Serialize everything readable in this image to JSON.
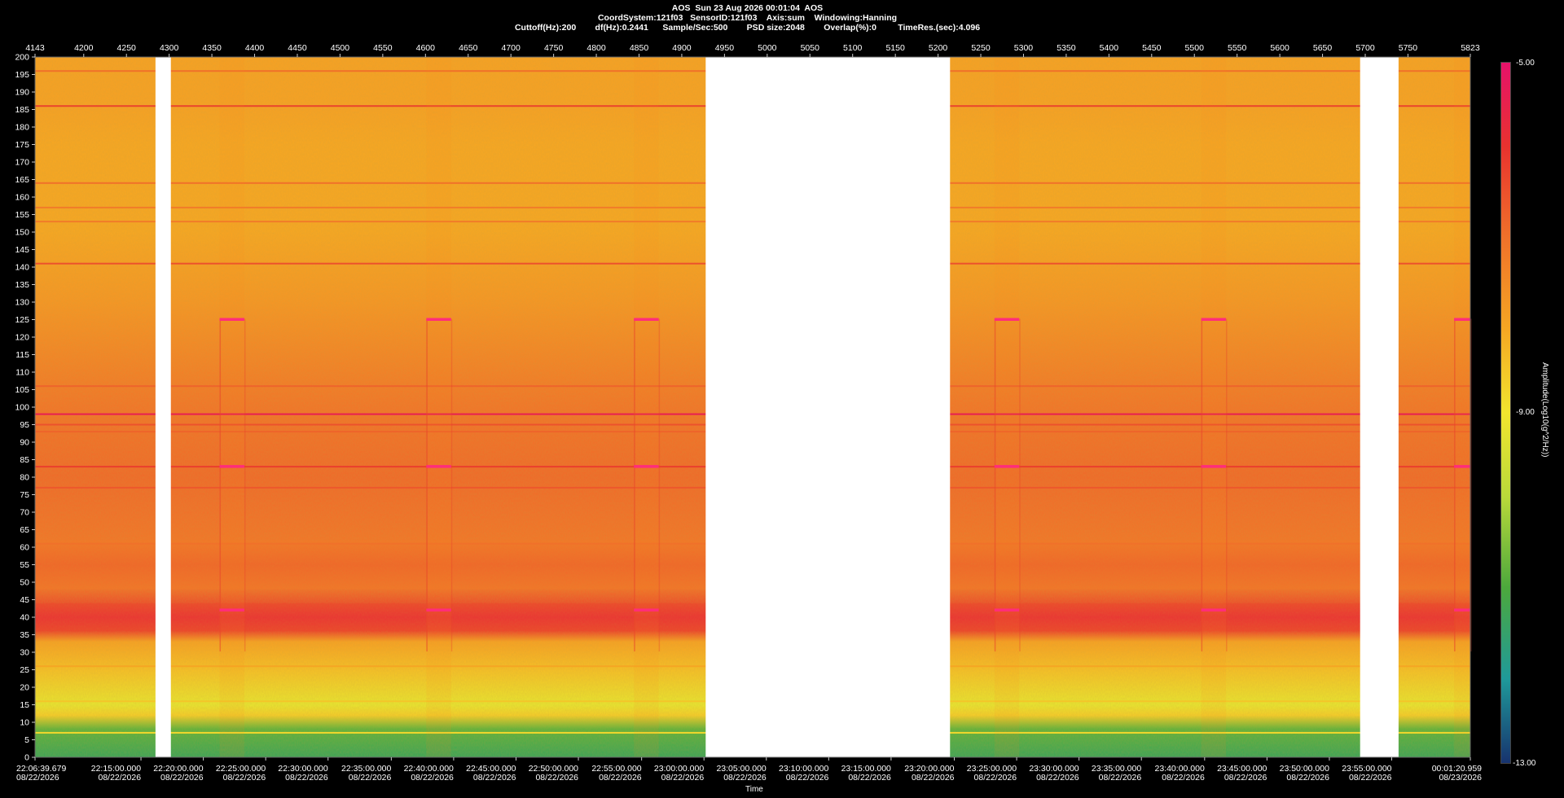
{
  "header": {
    "line1": "AOS  Sun 23 Aug 2026 00:01:04  AOS",
    "line2": "CoordSystem:121f03   SensorID:121f03    Axis:sum    Windowing:Hanning",
    "line3": "Cuttoff(Hz):200        df(Hz):0.2441      Sample/Sec:500        PSD size:2048        Overlap(%):0         TimeRes.(sec):4.096"
  },
  "colorbar": {
    "title": "Amplitude(Log10(g^2/Hz))",
    "max_label": "-5.00",
    "mid_label": "-9.00",
    "min_label": "-13.00",
    "range": [
      -13,
      -5
    ],
    "colors": [
      "#17336e",
      "#1f9a9a",
      "#4ca83c",
      "#b9d93a",
      "#f2e52e",
      "#f5a623",
      "#f0712a",
      "#e8322e",
      "#e6126a"
    ]
  },
  "x_axis_label": "Time",
  "chart_data": {
    "type": "heatmap",
    "title": "AOS  Sun 23 Aug 2026 00:01:04  AOS",
    "xlabel": "Time",
    "ylabel": "",
    "ylim": [
      0,
      200
    ],
    "y_ticks": [
      0,
      5,
      10,
      15,
      20,
      25,
      30,
      35,
      40,
      45,
      50,
      55,
      60,
      65,
      70,
      75,
      80,
      85,
      90,
      95,
      100,
      105,
      110,
      115,
      120,
      125,
      130,
      135,
      140,
      145,
      150,
      155,
      160,
      165,
      170,
      175,
      180,
      185,
      190,
      195,
      200
    ],
    "xlim_index": [
      4143,
      5823
    ],
    "top_ticks": [
      4143,
      4200,
      4250,
      4300,
      4350,
      4400,
      4450,
      4500,
      4550,
      4600,
      4650,
      4700,
      4750,
      4800,
      4850,
      4900,
      4950,
      5000,
      5050,
      5100,
      5150,
      5200,
      5250,
      5300,
      5350,
      5400,
      5450,
      5500,
      5550,
      5600,
      5650,
      5700,
      5750,
      5823
    ],
    "bottom_ticks": [
      {
        "index": 4143,
        "time": "22:06:39.679",
        "date": "08/22/2026"
      },
      {
        "index": 4267,
        "time": "22:15:00.000",
        "date": "08/22/2026"
      },
      {
        "index": 4340,
        "time": "22:20:00.000",
        "date": "08/22/2026"
      },
      {
        "index": 4413,
        "time": "22:25:00.000",
        "date": "08/22/2026"
      },
      {
        "index": 4486,
        "time": "22:30:00.000",
        "date": "08/22/2026"
      },
      {
        "index": 4560,
        "time": "22:35:00.000",
        "date": "08/22/2026"
      },
      {
        "index": 4633,
        "time": "22:40:00.000",
        "date": "08/22/2026"
      },
      {
        "index": 4706,
        "time": "22:45:00.000",
        "date": "08/22/2026"
      },
      {
        "index": 4779,
        "time": "22:50:00.000",
        "date": "08/22/2026"
      },
      {
        "index": 4853,
        "time": "22:55:00.000",
        "date": "08/22/2026"
      },
      {
        "index": 4926,
        "time": "23:00:00.000",
        "date": "08/22/2026"
      },
      {
        "index": 4999,
        "time": "23:05:00.000",
        "date": "08/22/2026"
      },
      {
        "index": 5072,
        "time": "23:10:00.000",
        "date": "08/22/2026"
      },
      {
        "index": 5145,
        "time": "23:15:00.000",
        "date": "08/22/2026"
      },
      {
        "index": 5219,
        "time": "23:20:00.000",
        "date": "08/22/2026"
      },
      {
        "index": 5292,
        "time": "23:25:00.000",
        "date": "08/22/2026"
      },
      {
        "index": 5365,
        "time": "23:30:00.000",
        "date": "08/22/2026"
      },
      {
        "index": 5438,
        "time": "23:35:00.000",
        "date": "08/22/2026"
      },
      {
        "index": 5512,
        "time": "23:40:00.000",
        "date": "08/22/2026"
      },
      {
        "index": 5585,
        "time": "23:45:00.000",
        "date": "08/22/2026"
      },
      {
        "index": 5658,
        "time": "23:50:00.000",
        "date": "08/22/2026"
      },
      {
        "index": 5731,
        "time": "23:55:00.000",
        "date": "08/22/2026"
      },
      {
        "index": 5823,
        "time": "00:01:20.959",
        "date": "08/23/2026"
      }
    ],
    "data_gaps_index": [
      [
        4284,
        4302
      ],
      [
        4928,
        5214
      ],
      [
        5694,
        5739
      ]
    ],
    "features": {
      "horizontal_lines_hz": [
        {
          "hz": 196,
          "level": -7.0
        },
        {
          "hz": 186,
          "level": -6.3
        },
        {
          "hz": 164,
          "level": -7.0
        },
        {
          "hz": 157,
          "level": -7.2
        },
        {
          "hz": 153,
          "level": -7.2
        },
        {
          "hz": 141,
          "level": -6.5
        },
        {
          "hz": 106,
          "level": -6.8
        },
        {
          "hz": 98,
          "level": -5.4
        },
        {
          "hz": 95,
          "level": -6.5
        },
        {
          "hz": 93,
          "level": -6.8
        },
        {
          "hz": 83,
          "level": -6.2
        },
        {
          "hz": 77,
          "level": -6.6
        },
        {
          "hz": 61,
          "level": -7.0
        },
        {
          "hz": 26,
          "level": -8.0
        },
        {
          "hz": 16,
          "level": -8.5
        },
        {
          "hz": 7,
          "level": -8.8
        }
      ],
      "broad_bands_hz": [
        {
          "from": 36,
          "to": 44,
          "level": -6.3
        },
        {
          "from": 48,
          "to": 62,
          "level": -7.2
        }
      ],
      "periodic_events": [
        {
          "start_index": 4359,
          "end_index": 4388
        },
        {
          "start_index": 4601,
          "end_index": 4630
        },
        {
          "start_index": 4844,
          "end_index": 4873
        },
        {
          "start_index": 5266,
          "end_index": 5295
        },
        {
          "start_index": 5508,
          "end_index": 5537
        },
        {
          "start_index": 5804,
          "end_index": 5823
        }
      ],
      "event_lines_hz": [
        125,
        83,
        42
      ]
    }
  }
}
